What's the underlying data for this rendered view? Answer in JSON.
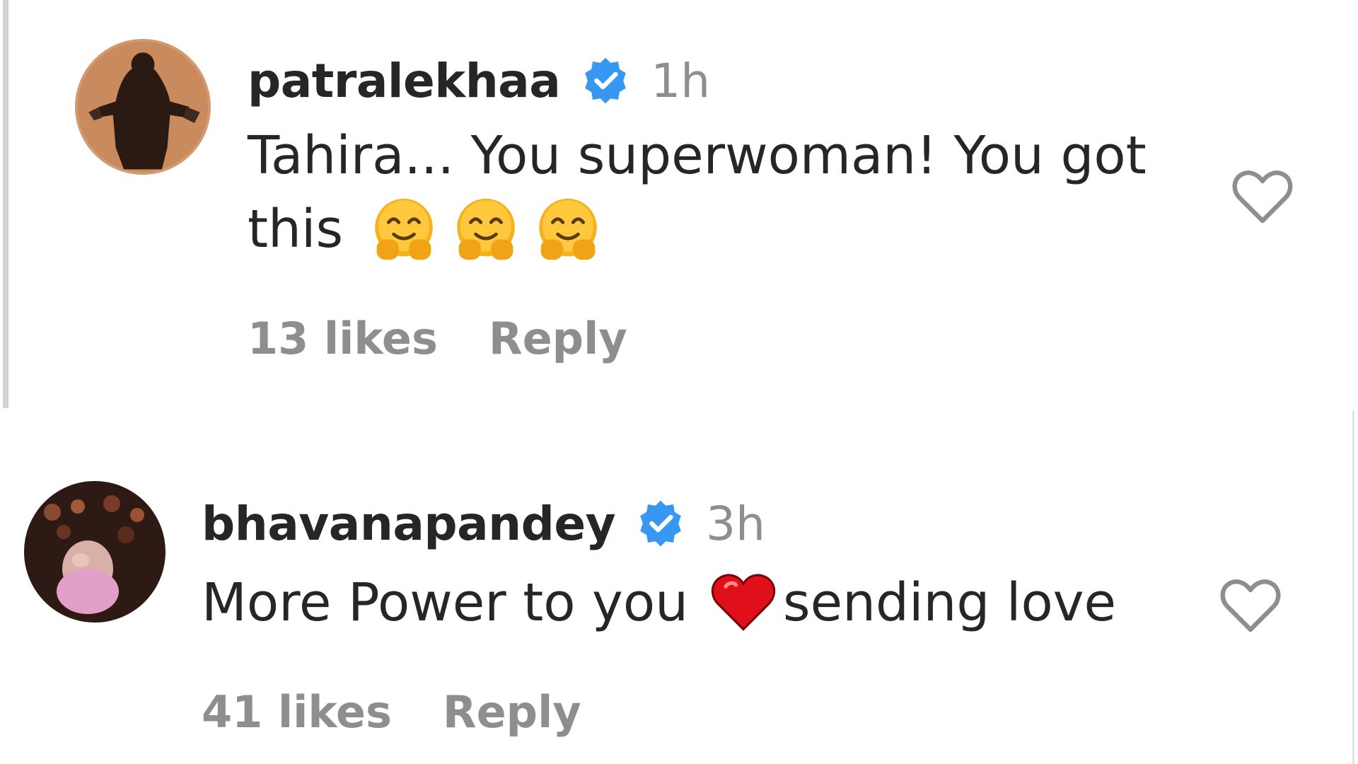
{
  "comments": [
    {
      "username": "patralekhaa",
      "verified": true,
      "time": "1h",
      "text_line1": "Tahira... You superwoman! You got",
      "text_line2": "this",
      "emojis": [
        "hugging-face",
        "hugging-face",
        "hugging-face"
      ],
      "likes": "13 likes",
      "reply": "Reply",
      "avatar_bg": "#d29a70"
    },
    {
      "username": "bhavanapandey",
      "verified": true,
      "time": "3h",
      "text_before_emoji": "More Power to you",
      "emoji": "red-heart",
      "text_after_emoji": "sending love",
      "likes": "41 likes",
      "reply": "Reply",
      "avatar_bg": "#2e1a14"
    }
  ],
  "colors": {
    "text": "#262626",
    "secondary": "#8e8e8e",
    "verified_blue": "#3897f0",
    "heart_red": "#e0101a",
    "emoji_yellow": "#f5b21e"
  }
}
